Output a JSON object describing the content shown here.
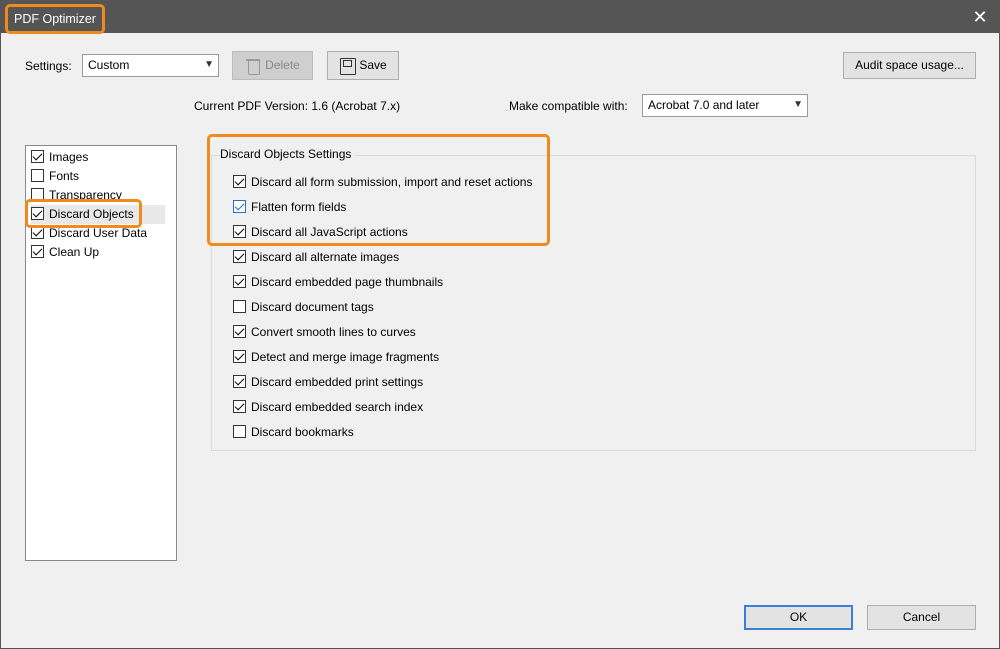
{
  "window": {
    "title": "PDF Optimizer",
    "close_glyph": "✕"
  },
  "toolbar": {
    "settings_label": "Settings:",
    "settings_value": "Custom",
    "delete_label": "Delete",
    "save_label": "Save",
    "audit_label": "Audit space usage..."
  },
  "info": {
    "version_text": "Current PDF Version: 1.6 (Acrobat 7.x)",
    "compat_label": "Make compatible with:",
    "compat_value": "Acrobat 7.0 and later"
  },
  "sidebar": {
    "items": [
      {
        "label": "Images",
        "checked": true
      },
      {
        "label": "Fonts",
        "checked": false
      },
      {
        "label": "Transparency",
        "checked": false
      },
      {
        "label": "Discard Objects",
        "checked": true,
        "selected": true
      },
      {
        "label": "Discard User Data",
        "checked": true
      },
      {
        "label": "Clean Up",
        "checked": true
      }
    ]
  },
  "panel": {
    "title": "Discard Objects Settings",
    "options": [
      {
        "label": "Discard all form submission, import and reset actions",
        "checked": true
      },
      {
        "label": "Flatten form fields",
        "checked": true,
        "focus": true
      },
      {
        "label": "Discard all JavaScript actions",
        "checked": true
      },
      {
        "label": "Discard all alternate images",
        "checked": true
      },
      {
        "label": "Discard embedded page thumbnails",
        "checked": true
      },
      {
        "label": "Discard document tags",
        "checked": false
      },
      {
        "label": "Convert smooth lines to curves",
        "checked": true
      },
      {
        "label": "Detect and merge image fragments",
        "checked": true
      },
      {
        "label": "Discard embedded print settings",
        "checked": true
      },
      {
        "label": "Discard embedded search index",
        "checked": true
      },
      {
        "label": "Discard bookmarks",
        "checked": false
      }
    ]
  },
  "footer": {
    "ok_label": "OK",
    "cancel_label": "Cancel"
  },
  "colors": {
    "highlight": "#ef8a1c",
    "titlebar": "#555555",
    "focus_blue": "#3c7fd8"
  }
}
